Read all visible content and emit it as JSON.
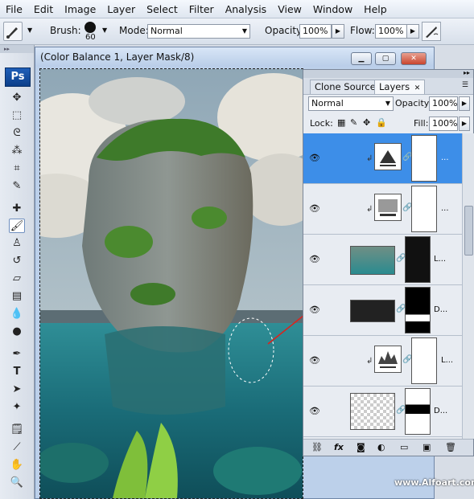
{
  "menubar": [
    "File",
    "Edit",
    "Image",
    "Layer",
    "Select",
    "Filter",
    "Analysis",
    "View",
    "Window",
    "Help"
  ],
  "options": {
    "brush_label": "Brush:",
    "brush_size": "60",
    "mode_label": "Mode:",
    "mode_value": "Normal",
    "opacity_label": "Opacity:",
    "opacity_value": "100%",
    "flow_label": "Flow:",
    "flow_value": "100%"
  },
  "toolbar": {
    "logo": "Ps"
  },
  "document": {
    "title": "(Color Balance 1, Layer Mask/8)"
  },
  "layers_panel": {
    "tabs": [
      "Clone Source",
      "Layers"
    ],
    "blend_mode": "Normal",
    "opacity_label": "Opacity:",
    "opacity_value": "100%",
    "lock_label": "Lock:",
    "fill_label": "Fill:",
    "fill_value": "100%",
    "layers": [
      {
        "label": "...",
        "selected": true
      },
      {
        "label": "..."
      },
      {
        "label": "L..."
      },
      {
        "label": "D..."
      },
      {
        "label": "L..."
      },
      {
        "label": "D..."
      }
    ]
  },
  "watermark": "www.Alfoart.com",
  "colors": {
    "selection": "#3d8ee8",
    "annotation_line": "#e0201a"
  }
}
